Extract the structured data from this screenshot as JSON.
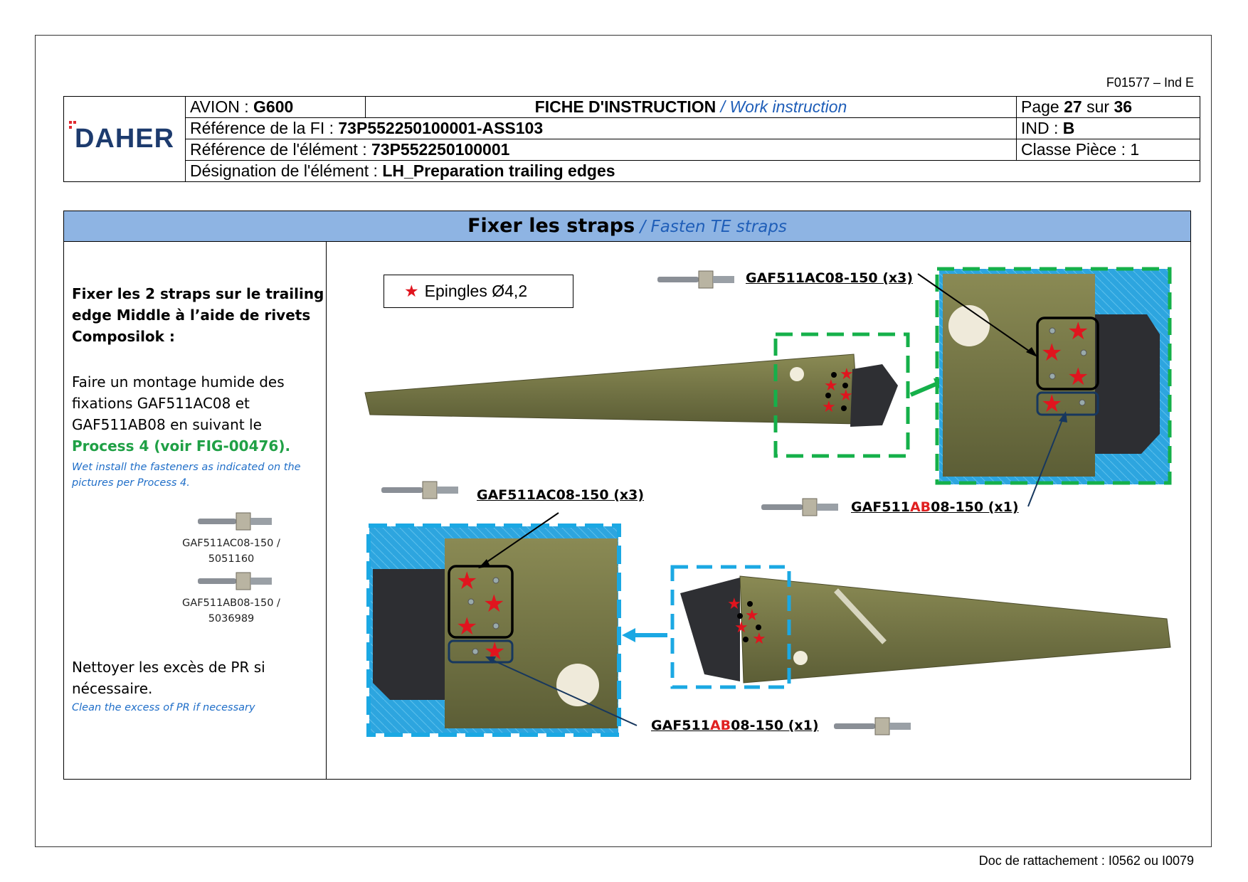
{
  "form_code": "F01577 – Ind E",
  "doc_attach": "Doc de rattachement : I0562 ou I0079",
  "logo_text": "DAHER",
  "header": {
    "avion_label": "AVION : ",
    "avion_value": "G600",
    "fiche_title": "FICHE D'INSTRUCTION",
    "fiche_subtitle": " / Work instruction",
    "page_label": "Page ",
    "page_num": "27",
    "page_sep": " sur ",
    "page_total": "36",
    "ref_fi_label": "Référence de la FI : ",
    "ref_fi_value": "73P552250100001-ASS103",
    "ind_label": "IND : ",
    "ind_value": "B",
    "ref_elem_label": "Référence de l'élément : ",
    "ref_elem_value": "73P552250100001",
    "classe": "Classe Pièce : 1",
    "desig_label": "Désignation de l'élément : ",
    "desig_value": "LH_Preparation trailing edges"
  },
  "section": {
    "title": "Fixer les straps",
    "title_en": " / Fasten TE straps"
  },
  "instructions": {
    "step1": [
      "Fixer les 2 straps sur le trailing",
      "edge Middle à l’aide de rivets",
      "Composilok :"
    ],
    "step2": [
      "Faire un montage humide des",
      "fixations GAF511AC08 et",
      "GAF511AB08 en suivant le"
    ],
    "step2_link": "Process 4 (voir FIG-00476).",
    "step2_en": [
      "Wet install the fasteners as indicated on the",
      "pictures per Process 4."
    ],
    "cap1": [
      "GAF511AC08-150 /",
      "5051160"
    ],
    "cap2": [
      "GAF511AB08-150 /",
      "5036989"
    ],
    "step3": [
      "Nettoyer les excès de PR si",
      "nécessaire."
    ],
    "step3_en": "Clean the excess of PR if necessary"
  },
  "legend": {
    "text": "Epingles Ø4,2"
  },
  "callouts": {
    "top_ac_pre": "GAF511AC08-150 (x3)",
    "top_ab_pre": "GAF511",
    "top_ab_red": "AB",
    "top_ab_post": "08-150 (x1)",
    "mid_ac": "GAF511AC08-150 (x3)",
    "bot_ab_pre": "GAF511",
    "bot_ab_red": "AB",
    "bot_ab_post": "08-150 (x1)"
  },
  "colors": {
    "accent": "#8eb4e3",
    "green_box": "#15b04a",
    "blue_box": "#1ba8e3",
    "star": "#e0141e",
    "logo": "#1d3b6e"
  }
}
